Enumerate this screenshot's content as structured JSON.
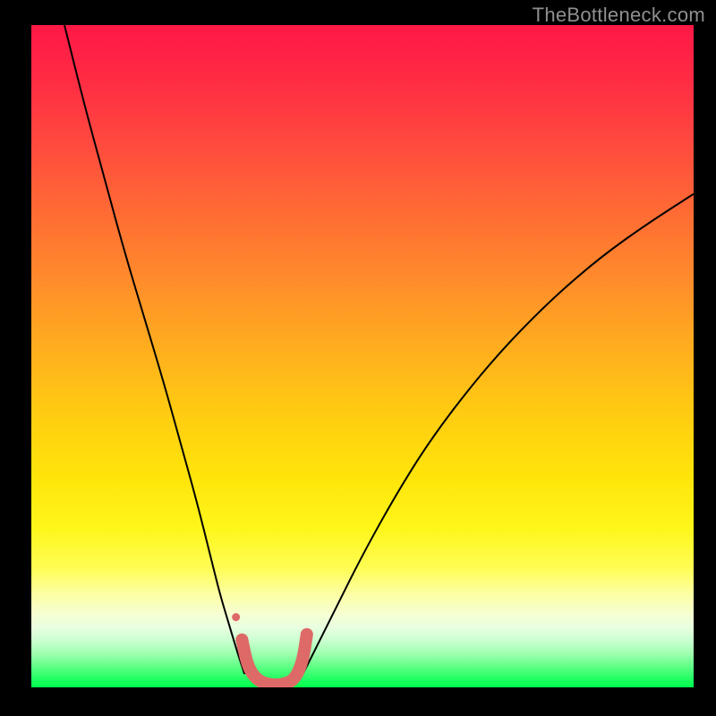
{
  "watermark": "TheBottleneck.com",
  "chart_data": {
    "type": "line",
    "title": "",
    "xlabel": "",
    "ylabel": "",
    "xlim": [
      0,
      1
    ],
    "ylim": [
      0,
      1
    ],
    "legend": false,
    "grid": false,
    "background_gradient": {
      "direction": "vertical",
      "stops": [
        {
          "pos": 0.0,
          "color": "#ff1846"
        },
        {
          "pos": 0.18,
          "color": "#ff4a3e"
        },
        {
          "pos": 0.38,
          "color": "#ff8a2c"
        },
        {
          "pos": 0.58,
          "color": "#ffca12"
        },
        {
          "pos": 0.76,
          "color": "#fff61a"
        },
        {
          "pos": 0.86,
          "color": "#fcffa5"
        },
        {
          "pos": 0.93,
          "color": "#c9ffcf"
        },
        {
          "pos": 1.0,
          "color": "#00ff4c"
        }
      ]
    },
    "series": [
      {
        "name": "left-curve",
        "color": "#000000",
        "width": 2,
        "x": [
          0.05,
          0.08,
          0.11,
          0.14,
          0.17,
          0.2,
          0.225,
          0.25,
          0.27,
          0.285,
          0.3,
          0.312,
          0.322
        ],
        "y": [
          1.0,
          0.88,
          0.77,
          0.66,
          0.56,
          0.46,
          0.37,
          0.28,
          0.2,
          0.14,
          0.09,
          0.05,
          0.02
        ]
      },
      {
        "name": "right-curve",
        "color": "#000000",
        "width": 2,
        "x": [
          0.41,
          0.43,
          0.46,
          0.5,
          0.55,
          0.6,
          0.66,
          0.72,
          0.79,
          0.86,
          0.93,
          1.0
        ],
        "y": [
          0.02,
          0.06,
          0.12,
          0.2,
          0.29,
          0.37,
          0.45,
          0.52,
          0.59,
          0.65,
          0.7,
          0.745
        ]
      },
      {
        "name": "valley-highlight",
        "color": "#de6a67",
        "width": 14,
        "linecap": "round",
        "x": [
          0.318,
          0.327,
          0.342,
          0.36,
          0.38,
          0.398,
          0.41,
          0.416
        ],
        "y": [
          0.072,
          0.03,
          0.01,
          0.004,
          0.004,
          0.012,
          0.04,
          0.08
        ]
      },
      {
        "name": "valley-dot",
        "type": "scatter",
        "color": "#de6a67",
        "size": 9,
        "x": [
          0.309
        ],
        "y": [
          0.106
        ]
      }
    ]
  }
}
